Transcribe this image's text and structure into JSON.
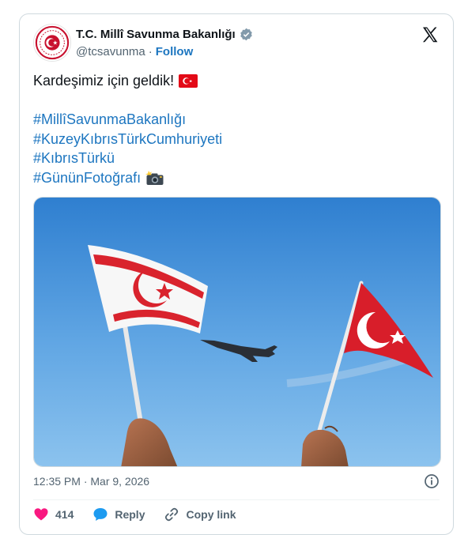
{
  "account": {
    "display_name": "T.C. Millî Savunma Bakanlığı",
    "handle": "@tcsavunma",
    "separator": "·",
    "follow_label": "Follow"
  },
  "tweet": {
    "text": "Kardeşimiz için geldik!",
    "hashtags": [
      "#MillîSavunmaBakanlığı",
      "#KuzeyKıbrısTürkCumhuriyeti",
      "#KıbrısTürkü",
      "#GününFotoğrafı"
    ],
    "timestamp": "12:35 PM · Mar 9, 2026"
  },
  "actions": {
    "like_count": "414",
    "reply_label": "Reply",
    "copy_label": "Copy link"
  },
  "colors": {
    "link": "#1d76c0",
    "like": "#f91880",
    "reply": "#1d9bf0",
    "verified": "#829aab",
    "avatar_red": "#c8102e"
  },
  "icons": [
    "verified-icon",
    "x-logo-icon",
    "turkey-flag-emoji",
    "camera-flash-emoji",
    "info-icon",
    "heart-icon",
    "reply-bubble-icon",
    "link-icon"
  ]
}
